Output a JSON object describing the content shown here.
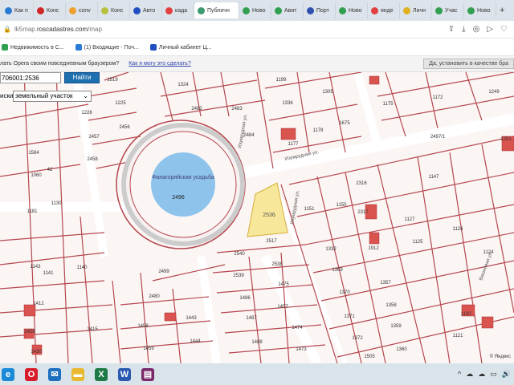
{
  "browser": {
    "tabs": [
      {
        "label": "Как п",
        "color": "#2a7bd5"
      },
      {
        "label": "Конс",
        "color": "#d02828"
      },
      {
        "label": "conv",
        "color": "#f0a030"
      },
      {
        "label": "Конс",
        "color": "#b8c040"
      },
      {
        "label": "Авто",
        "color": "#2050c0"
      },
      {
        "label": "када",
        "color": "#e04040"
      },
      {
        "label": "Публичн",
        "color": "#3a9a70",
        "active": true
      },
      {
        "label": "Ново",
        "color": "#30a050"
      },
      {
        "label": "Авит",
        "color": "#30a050"
      },
      {
        "label": "Порт",
        "color": "#3050b0"
      },
      {
        "label": "Ново",
        "color": "#30a050"
      },
      {
        "label": "янде",
        "color": "#e04040"
      },
      {
        "label": "Личн",
        "color": "#e0b020"
      },
      {
        "label": "Учас",
        "color": "#30a050"
      },
      {
        "label": "Ново",
        "color": "#30a050"
      }
    ],
    "new_tab": "+",
    "url_prefix": "lk5map.",
    "url_domain": "roscadastres.com",
    "url_path": "/map",
    "toolbar_icons": [
      "share-icon",
      "download-icon",
      "location-icon",
      "play-icon",
      "heart-icon"
    ],
    "bookmarks": [
      {
        "label": "Недвижимость в С...",
        "color": "#30a050"
      },
      {
        "label": "(1) Входящие - Поч...",
        "color": "#2a7bd5"
      },
      {
        "label": "Личный кабинет Ц...",
        "color": "#2050c0"
      }
    ],
    "default_prompt": {
      "text": "лать Opera своим повседневным браузером?",
      "link": "Как я могу это сделать?",
      "button": "Да, установить в качестве бра"
    }
  },
  "search": {
    "value": "706001:2536",
    "button": "Найти",
    "type_label": "иски:",
    "type_value": "земельный участок"
  },
  "map": {
    "selected_parcel": "2536",
    "plaza_label": "Фанагорийская усадьба",
    "plaza_number": "2496",
    "street_labels": [
      "Изумрудная ул.",
      "Изумрудная ул.",
      "Изумрудная ул.",
      "Вишнёвая ул."
    ],
    "parcels": [
      "1519",
      "1324",
      "1199",
      "1305",
      "1225",
      "1336",
      "1175",
      "1172",
      "1249",
      "2482",
      "2483",
      "1226",
      "2456",
      "2457",
      "1177",
      "1178",
      "1675",
      "2484",
      "1584",
      "2458",
      "2497/1",
      "1251",
      "1060",
      "42",
      "1147",
      "1151",
      "1150",
      "2316",
      "2317",
      "1181",
      "1130",
      "1127",
      "1126",
      "1125",
      "2517",
      "1332",
      "1912",
      "1124",
      "2540",
      "2538",
      "1369",
      "1143",
      "1141",
      "1140",
      "2539",
      "1475",
      "1357",
      "1486",
      "2499",
      "2480",
      "1370",
      "1358",
      "1412",
      "1457",
      "1429",
      "1487",
      "1458",
      "1443",
      "1371",
      "1359",
      "1120",
      "1415",
      "1474",
      "1488",
      "1444",
      "1372",
      "1121",
      "1459",
      "1430",
      "1473",
      "1360",
      "1505"
    ],
    "attribution": "© Яндекс",
    "colors": {
      "line": "#b5474f",
      "selected": "#f6e79a",
      "plaza": "#8ec3ec",
      "building": "#d9534f"
    }
  },
  "taskbar": {
    "apps": [
      {
        "name": "edge",
        "glyph": "e",
        "color": "#1a8ad8"
      },
      {
        "name": "opera",
        "glyph": "O",
        "color": "#d81e2a"
      },
      {
        "name": "mail",
        "glyph": "✉",
        "color": "#1d6fc0"
      },
      {
        "name": "explorer",
        "glyph": "▬",
        "color": "#e8b830"
      },
      {
        "name": "excel",
        "glyph": "X",
        "color": "#1e7a44"
      },
      {
        "name": "word",
        "glyph": "W",
        "color": "#2a5ab0"
      },
      {
        "name": "winrar",
        "glyph": "▤",
        "color": "#7a2a6a"
      }
    ],
    "tray": [
      "^",
      "☁",
      "☁",
      "▭",
      "🔊"
    ]
  }
}
